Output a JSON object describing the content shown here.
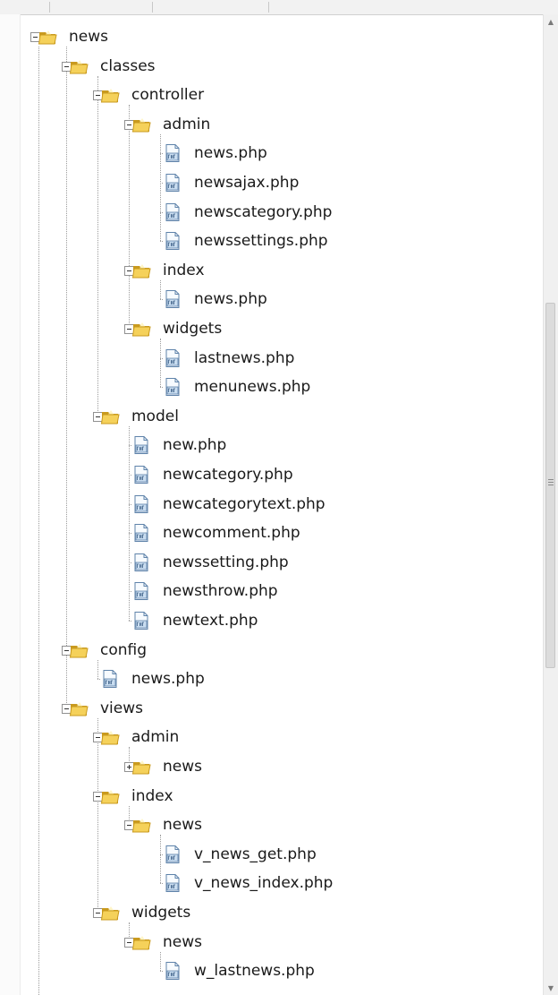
{
  "tree": {
    "items": [
      {
        "label": "news",
        "type": "folder",
        "depth": 0,
        "expanded": true
      },
      {
        "label": "classes",
        "type": "folder",
        "depth": 1,
        "expanded": true
      },
      {
        "label": "controller",
        "type": "folder",
        "depth": 2,
        "expanded": true
      },
      {
        "label": "admin",
        "type": "folder",
        "depth": 3,
        "expanded": true
      },
      {
        "label": "news.php",
        "type": "file",
        "depth": 4
      },
      {
        "label": "newsajax.php",
        "type": "file",
        "depth": 4
      },
      {
        "label": "newscategory.php",
        "type": "file",
        "depth": 4
      },
      {
        "label": "newssettings.php",
        "type": "file",
        "depth": 4
      },
      {
        "label": "index",
        "type": "folder",
        "depth": 3,
        "expanded": true
      },
      {
        "label": "news.php",
        "type": "file",
        "depth": 4
      },
      {
        "label": "widgets",
        "type": "folder",
        "depth": 3,
        "expanded": true
      },
      {
        "label": "lastnews.php",
        "type": "file",
        "depth": 4
      },
      {
        "label": "menunews.php",
        "type": "file",
        "depth": 4
      },
      {
        "label": "model",
        "type": "folder",
        "depth": 2,
        "expanded": true
      },
      {
        "label": "new.php",
        "type": "file",
        "depth": 3
      },
      {
        "label": "newcategory.php",
        "type": "file",
        "depth": 3
      },
      {
        "label": "newcategorytext.php",
        "type": "file",
        "depth": 3
      },
      {
        "label": "newcomment.php",
        "type": "file",
        "depth": 3
      },
      {
        "label": "newssetting.php",
        "type": "file",
        "depth": 3
      },
      {
        "label": "newsthrow.php",
        "type": "file",
        "depth": 3
      },
      {
        "label": "newtext.php",
        "type": "file",
        "depth": 3
      },
      {
        "label": "config",
        "type": "folder",
        "depth": 1,
        "expanded": true
      },
      {
        "label": "news.php",
        "type": "file",
        "depth": 2
      },
      {
        "label": "views",
        "type": "folder",
        "depth": 1,
        "expanded": true
      },
      {
        "label": "admin",
        "type": "folder",
        "depth": 2,
        "expanded": true
      },
      {
        "label": "news",
        "type": "folder",
        "depth": 3,
        "expanded": false
      },
      {
        "label": "index",
        "type": "folder",
        "depth": 2,
        "expanded": true
      },
      {
        "label": "news",
        "type": "folder",
        "depth": 3,
        "expanded": true
      },
      {
        "label": "v_news_get.php",
        "type": "file",
        "depth": 4
      },
      {
        "label": "v_news_index.php",
        "type": "file",
        "depth": 4
      },
      {
        "label": "widgets",
        "type": "folder",
        "depth": 2,
        "expanded": true
      },
      {
        "label": "news",
        "type": "folder",
        "depth": 3,
        "expanded": true
      },
      {
        "label": "w_lastnews.php",
        "type": "file",
        "depth": 4
      }
    ]
  },
  "icons": {
    "folder": "folder-icon",
    "file": "php-file-icon"
  },
  "colors": {
    "folder_fill": "#f5d15a",
    "folder_dark": "#c99a1e",
    "file_fill": "#c9ddf0",
    "file_border": "#5f83aa"
  }
}
